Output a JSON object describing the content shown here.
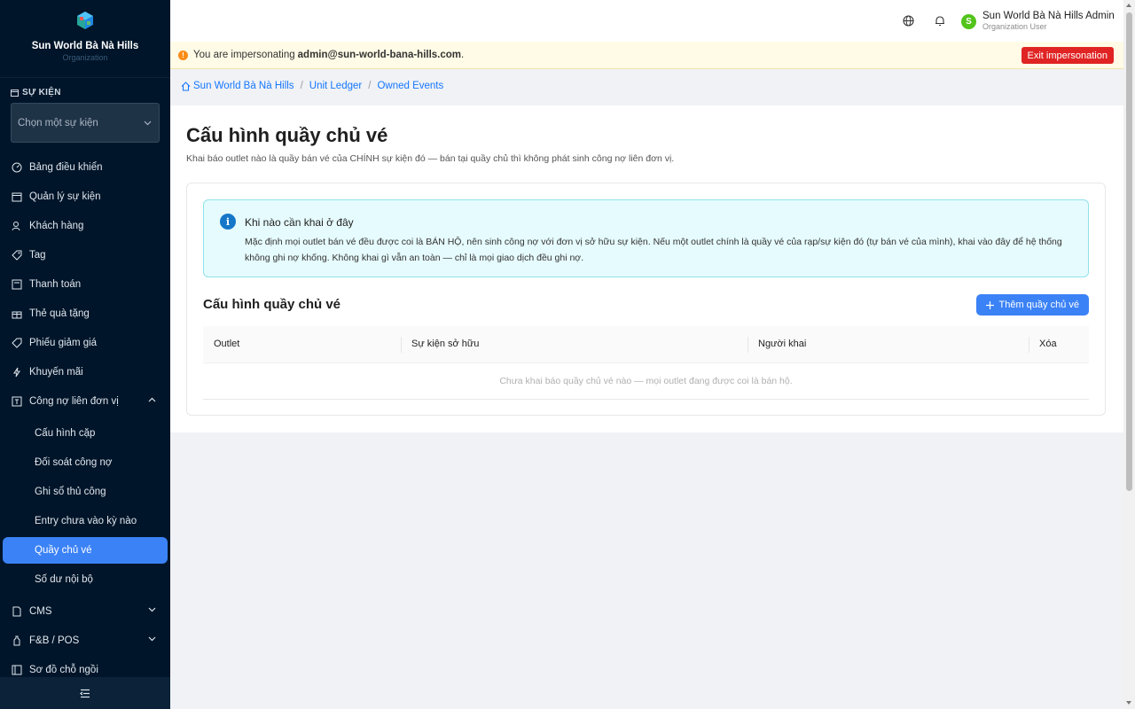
{
  "brand": {
    "name": "Sun World Bà Nà Hills",
    "subtitle": "Organization"
  },
  "event_section": {
    "label": "SỰ KIỆN",
    "select_placeholder": "Chọn một sự kiện"
  },
  "sidebar": {
    "items": [
      {
        "label": "Bảng điều khiển",
        "icon": "dashboard-icon"
      },
      {
        "label": "Quản lý sự kiện",
        "icon": "calendar-icon"
      },
      {
        "label": "Khách hàng",
        "icon": "users-icon"
      },
      {
        "label": "Tag",
        "icon": "tag-icon"
      },
      {
        "label": "Thanh toán",
        "icon": "payment-icon"
      },
      {
        "label": "Thẻ quà tặng",
        "icon": "gift-icon"
      },
      {
        "label": "Phiếu giảm giá",
        "icon": "coupon-icon"
      },
      {
        "label": "Khuyến mãi",
        "icon": "flash-icon"
      },
      {
        "label": "Công nợ liên đơn vị",
        "icon": "ledger-icon"
      }
    ],
    "sub_items": [
      {
        "label": "Cấu hình cặp"
      },
      {
        "label": "Đối soát công nợ"
      },
      {
        "label": "Ghi sổ thủ công"
      },
      {
        "label": "Entry chưa vào kỳ nào"
      },
      {
        "label": "Quầy chủ vé",
        "active": true
      },
      {
        "label": "Số dư nội bộ"
      }
    ],
    "bottom_items": [
      {
        "label": "CMS",
        "icon": "file-icon"
      },
      {
        "label": "F&B / POS",
        "icon": "pos-icon"
      },
      {
        "label": "Sơ đồ chỗ ngồi",
        "icon": "seatmap-icon"
      }
    ]
  },
  "header": {
    "user_name": "Sun World Bà Nà Hills Admin",
    "user_role": "Organization User",
    "avatar_letter": "S"
  },
  "impersonation": {
    "prefix": "You are impersonating",
    "email": "admin@sun-world-bana-hills.com",
    "suffix": ".",
    "exit_label": "Exit impersonation"
  },
  "breadcrumb": [
    "Sun World Bà Nà Hills",
    "Unit Ledger",
    "Owned Events"
  ],
  "page": {
    "title": "Cấu hình quầy chủ vé",
    "description": "Khai báo outlet nào là quầy bán vé của CHÍNH sự kiện đó — bán tại quầy chủ thì không phát sinh công nợ liên đơn vị."
  },
  "info_alert": {
    "title": "Khi nào cần khai ở đây",
    "body": "Mặc định mọi outlet bán vé đều được coi là BÁN HỘ, nên sinh công nợ với đơn vị sở hữu sự kiện. Nếu một outlet chính là quầy vé của rạp/sự kiện đó (tự bán vé của mình), khai vào đây để hệ thống không ghi nợ khống. Không khai gì vẫn an toàn — chỉ là mọi giao dịch đều ghi nợ."
  },
  "section": {
    "title": "Cấu hình quầy chủ vé",
    "add_button": "Thêm quầy chủ vé"
  },
  "table": {
    "columns": [
      "Outlet",
      "Sự kiện sở hữu",
      "Người khai",
      "Xóa"
    ],
    "empty_text": "Chưa khai báo quầy chủ vé nào — mọi outlet đang được coi là bán hộ."
  },
  "colors": {
    "sidebar_bg": "#001529",
    "accent": "#3b82f6",
    "danger": "#e02424",
    "warning_bg": "#fffbe6",
    "info_bg": "#e6fbfd"
  }
}
